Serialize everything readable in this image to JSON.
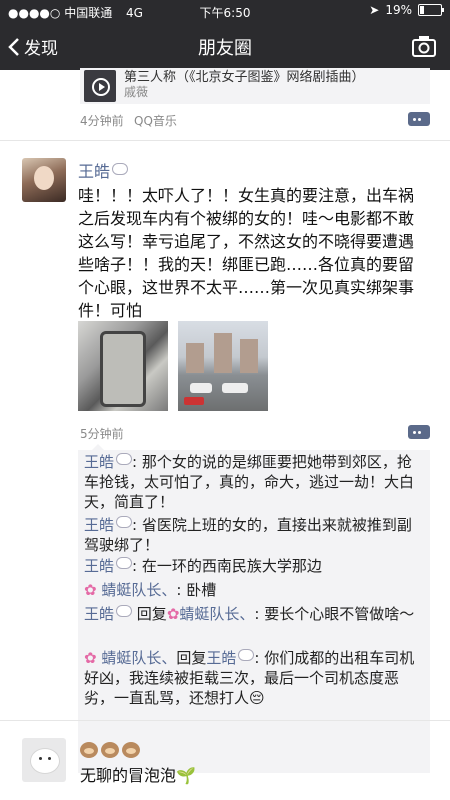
{
  "status_bar": {
    "carrier": "中国联通",
    "network": "4G",
    "time": "下午6:50",
    "battery": "19%",
    "battery_level": 0.19
  },
  "nav": {
    "back_label": "发现",
    "title": "朋友圈",
    "camera_icon": "camera-icon"
  },
  "prev_post": {
    "music_title": "第三人称（《北京女子图鉴》网络剧插曲）",
    "music_artist": "戚薇",
    "time": "4分钟前",
    "source": "QQ音乐"
  },
  "post": {
    "username": "王皓",
    "text": "哇！！！太吓人了！！女生真的要注意，出车祸之后发现车内有个被绑的女的！哇～电影都不敢这么写！幸亏追尾了，不然这女的不晓得要遭遇些啥子！！我的天！绑匪已跑……各位真的要留个心眼，这世界不太平……第一次见真实绑架事件！可怕",
    "time": "5分钟前",
    "comments": [
      {
        "author": "王皓",
        "text": "那个女的说的是绑匪要把她带到郊区，抢车抢钱，太可怕了，真的，命大，逃过一劫！大白天，简直了！"
      },
      {
        "author": "王皓",
        "text": "省医院上班的女的，直接出来就被推到副驾驶绑了！"
      },
      {
        "author": "王皓",
        "text": "在一环的西南民族大学那边"
      },
      {
        "author": "蜻蜓队长、",
        "text": "卧槽"
      },
      {
        "author": "王皓",
        "reply_label": "回复",
        "reply_to": "蜻蜓队长、",
        "text": "要长个心眼不管做啥～"
      },
      {
        "author": "蜻蜓队长、",
        "reply_label": "回复",
        "reply_to": "王皓",
        "text": "你们成都的出租车司机好凶，我连续被拒载三次，最后一个司机态度恶劣，一直乱骂，还想打人😔"
      }
    ]
  },
  "next_post": {
    "text": "无聊的冒泡泡"
  }
}
